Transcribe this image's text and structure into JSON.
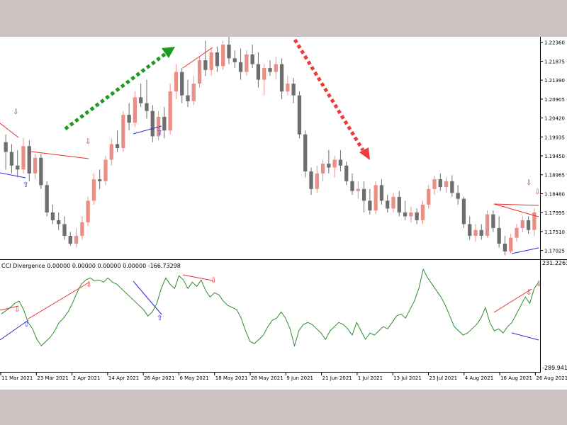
{
  "chart_data": [
    {
      "type": "candlestick",
      "title": "",
      "price_axis": {
        "ticks": [
          "1.22360",
          "1.21875",
          "1.21390",
          "1.20905",
          "1.20420",
          "1.19935",
          "1.19450",
          "1.18965",
          "1.18480",
          "1.17995",
          "1.17510",
          "1.17025"
        ],
        "range": [
          1.168,
          1.225
        ]
      },
      "candles": [
        {
          "o": 1.198,
          "h": 1.2,
          "l": 1.191,
          "c": 1.1955
        },
        {
          "o": 1.1955,
          "h": 1.1975,
          "l": 1.19,
          "c": 1.192
        },
        {
          "o": 1.192,
          "h": 1.196,
          "l": 1.189,
          "c": 1.191
        },
        {
          "o": 1.191,
          "h": 1.199,
          "l": 1.19,
          "c": 1.197
        },
        {
          "o": 1.197,
          "h": 1.1985,
          "l": 1.188,
          "c": 1.19
        },
        {
          "o": 1.19,
          "h": 1.195,
          "l": 1.1885,
          "c": 1.194
        },
        {
          "o": 1.194,
          "h": 1.195,
          "l": 1.186,
          "c": 1.187
        },
        {
          "o": 1.187,
          "h": 1.188,
          "l": 1.179,
          "c": 1.18
        },
        {
          "o": 1.18,
          "h": 1.182,
          "l": 1.177,
          "c": 1.178
        },
        {
          "o": 1.178,
          "h": 1.18,
          "l": 1.1755,
          "c": 1.177
        },
        {
          "o": 1.177,
          "h": 1.179,
          "l": 1.173,
          "c": 1.174
        },
        {
          "o": 1.174,
          "h": 1.175,
          "l": 1.1715,
          "c": 1.172
        },
        {
          "o": 1.172,
          "h": 1.176,
          "l": 1.171,
          "c": 1.174
        },
        {
          "o": 1.174,
          "h": 1.179,
          "l": 1.173,
          "c": 1.1775
        },
        {
          "o": 1.1775,
          "h": 1.184,
          "l": 1.1765,
          "c": 1.183
        },
        {
          "o": 1.183,
          "h": 1.19,
          "l": 1.182,
          "c": 1.1885
        },
        {
          "o": 1.1885,
          "h": 1.191,
          "l": 1.186,
          "c": 1.188
        },
        {
          "o": 1.188,
          "h": 1.1945,
          "l": 1.187,
          "c": 1.1935
        },
        {
          "o": 1.1935,
          "h": 1.199,
          "l": 1.192,
          "c": 1.1975
        },
        {
          "o": 1.1975,
          "h": 1.201,
          "l": 1.1955,
          "c": 1.1965
        },
        {
          "o": 1.1965,
          "h": 1.206,
          "l": 1.1955,
          "c": 1.205
        },
        {
          "o": 1.205,
          "h": 1.208,
          "l": 1.201,
          "c": 1.203
        },
        {
          "o": 1.203,
          "h": 1.211,
          "l": 1.202,
          "c": 1.2095
        },
        {
          "o": 1.2095,
          "h": 1.213,
          "l": 1.207,
          "c": 1.208
        },
        {
          "o": 1.208,
          "h": 1.214,
          "l": 1.204,
          "c": 1.206
        },
        {
          "o": 1.206,
          "h": 1.2075,
          "l": 1.198,
          "c": 1.1995
        },
        {
          "o": 1.1995,
          "h": 1.206,
          "l": 1.1985,
          "c": 1.2045
        },
        {
          "o": 1.2045,
          "h": 1.207,
          "l": 1.199,
          "c": 1.201
        },
        {
          "o": 1.201,
          "h": 1.213,
          "l": 1.2,
          "c": 1.211
        },
        {
          "o": 1.211,
          "h": 1.218,
          "l": 1.209,
          "c": 1.216
        },
        {
          "o": 1.216,
          "h": 1.217,
          "l": 1.208,
          "c": 1.21
        },
        {
          "o": 1.21,
          "h": 1.214,
          "l": 1.207,
          "c": 1.2085
        },
        {
          "o": 1.2085,
          "h": 1.215,
          "l": 1.2075,
          "c": 1.213
        },
        {
          "o": 1.213,
          "h": 1.22,
          "l": 1.212,
          "c": 1.219
        },
        {
          "o": 1.219,
          "h": 1.224,
          "l": 1.215,
          "c": 1.2165
        },
        {
          "o": 1.2165,
          "h": 1.222,
          "l": 1.215,
          "c": 1.221
        },
        {
          "o": 1.221,
          "h": 1.2225,
          "l": 1.216,
          "c": 1.2175
        },
        {
          "o": 1.2175,
          "h": 1.224,
          "l": 1.2165,
          "c": 1.223
        },
        {
          "o": 1.223,
          "h": 1.225,
          "l": 1.218,
          "c": 1.2195
        },
        {
          "o": 1.2195,
          "h": 1.2215,
          "l": 1.217,
          "c": 1.2185
        },
        {
          "o": 1.2185,
          "h": 1.222,
          "l": 1.214,
          "c": 1.216
        },
        {
          "o": 1.216,
          "h": 1.2215,
          "l": 1.215,
          "c": 1.2205
        },
        {
          "o": 1.2205,
          "h": 1.223,
          "l": 1.217,
          "c": 1.218
        },
        {
          "o": 1.218,
          "h": 1.221,
          "l": 1.212,
          "c": 1.214
        },
        {
          "o": 1.214,
          "h": 1.218,
          "l": 1.21,
          "c": 1.217
        },
        {
          "o": 1.217,
          "h": 1.219,
          "l": 1.215,
          "c": 1.216
        },
        {
          "o": 1.216,
          "h": 1.22,
          "l": 1.214,
          "c": 1.218
        },
        {
          "o": 1.218,
          "h": 1.2195,
          "l": 1.209,
          "c": 1.211
        },
        {
          "o": 1.211,
          "h": 1.215,
          "l": 1.21,
          "c": 1.213
        },
        {
          "o": 1.213,
          "h": 1.2145,
          "l": 1.208,
          "c": 1.21
        },
        {
          "o": 1.21,
          "h": 1.211,
          "l": 1.199,
          "c": 1.2
        },
        {
          "o": 1.2,
          "h": 1.201,
          "l": 1.189,
          "c": 1.1905
        },
        {
          "o": 1.1905,
          "h": 1.1915,
          "l": 1.1845,
          "c": 1.186
        },
        {
          "o": 1.186,
          "h": 1.192,
          "l": 1.185,
          "c": 1.19
        },
        {
          "o": 1.19,
          "h": 1.1935,
          "l": 1.188,
          "c": 1.1925
        },
        {
          "o": 1.1925,
          "h": 1.196,
          "l": 1.19,
          "c": 1.1915
        },
        {
          "o": 1.1915,
          "h": 1.1945,
          "l": 1.189,
          "c": 1.1935
        },
        {
          "o": 1.1935,
          "h": 1.196,
          "l": 1.1905,
          "c": 1.192
        },
        {
          "o": 1.192,
          "h": 1.193,
          "l": 1.187,
          "c": 1.188
        },
        {
          "o": 1.188,
          "h": 1.19,
          "l": 1.1845,
          "c": 1.1855
        },
        {
          "o": 1.1855,
          "h": 1.188,
          "l": 1.1835,
          "c": 1.186
        },
        {
          "o": 1.186,
          "h": 1.188,
          "l": 1.18,
          "c": 1.183
        },
        {
          "o": 1.183,
          "h": 1.186,
          "l": 1.1795,
          "c": 1.1805
        },
        {
          "o": 1.1805,
          "h": 1.188,
          "l": 1.1795,
          "c": 1.187
        },
        {
          "o": 1.187,
          "h": 1.1885,
          "l": 1.182,
          "c": 1.183
        },
        {
          "o": 1.183,
          "h": 1.1845,
          "l": 1.18,
          "c": 1.181
        },
        {
          "o": 1.181,
          "h": 1.185,
          "l": 1.18,
          "c": 1.184
        },
        {
          "o": 1.184,
          "h": 1.1855,
          "l": 1.179,
          "c": 1.18
        },
        {
          "o": 1.18,
          "h": 1.183,
          "l": 1.178,
          "c": 1.179
        },
        {
          "o": 1.179,
          "h": 1.1815,
          "l": 1.1775,
          "c": 1.18
        },
        {
          "o": 1.18,
          "h": 1.181,
          "l": 1.177,
          "c": 1.178
        },
        {
          "o": 1.178,
          "h": 1.183,
          "l": 1.177,
          "c": 1.182
        },
        {
          "o": 1.182,
          "h": 1.187,
          "l": 1.181,
          "c": 1.186
        },
        {
          "o": 1.186,
          "h": 1.1895,
          "l": 1.1845,
          "c": 1.1885
        },
        {
          "o": 1.1885,
          "h": 1.19,
          "l": 1.1855,
          "c": 1.1865
        },
        {
          "o": 1.1865,
          "h": 1.189,
          "l": 1.185,
          "c": 1.188
        },
        {
          "o": 1.188,
          "h": 1.1895,
          "l": 1.184,
          "c": 1.185
        },
        {
          "o": 1.185,
          "h": 1.187,
          "l": 1.182,
          "c": 1.1835
        },
        {
          "o": 1.1835,
          "h": 1.184,
          "l": 1.176,
          "c": 1.177
        },
        {
          "o": 1.177,
          "h": 1.179,
          "l": 1.173,
          "c": 1.174
        },
        {
          "o": 1.174,
          "h": 1.177,
          "l": 1.1725,
          "c": 1.1755
        },
        {
          "o": 1.1755,
          "h": 1.177,
          "l": 1.173,
          "c": 1.174
        },
        {
          "o": 1.174,
          "h": 1.1805,
          "l": 1.1735,
          "c": 1.1795
        },
        {
          "o": 1.1795,
          "h": 1.1805,
          "l": 1.175,
          "c": 1.176
        },
        {
          "o": 1.176,
          "h": 1.179,
          "l": 1.171,
          "c": 1.172
        },
        {
          "o": 1.172,
          "h": 1.174,
          "l": 1.169,
          "c": 1.17
        },
        {
          "o": 1.17,
          "h": 1.1745,
          "l": 1.1695,
          "c": 1.1735
        },
        {
          "o": 1.1735,
          "h": 1.177,
          "l": 1.1725,
          "c": 1.176
        },
        {
          "o": 1.176,
          "h": 1.179,
          "l": 1.175,
          "c": 1.178
        },
        {
          "o": 1.178,
          "h": 1.179,
          "l": 1.1745,
          "c": 1.1755
        },
        {
          "o": 1.1755,
          "h": 1.181,
          "l": 1.174,
          "c": 1.18
        }
      ],
      "cci_label": "CCI Divergence 0.00000 0.00000 0.00000 0.00000 -166.73298",
      "cci_axis": {
        "max_label": "231.22637",
        "min_label": "-289.94150",
        "range": [
          -289.9415,
          231.22637
        ]
      },
      "cci_values": [
        -20,
        -5,
        10,
        30,
        40,
        0,
        -60,
        -90,
        -140,
        -170,
        -150,
        -130,
        -100,
        -60,
        -40,
        -10,
        30,
        80,
        120,
        140,
        150,
        135,
        140,
        130,
        150,
        130,
        120,
        100,
        80,
        60,
        40,
        20,
        0,
        -30,
        -10,
        30,
        100,
        150,
        120,
        100,
        160,
        140,
        100,
        130,
        110,
        140,
        90,
        60,
        80,
        70,
        40,
        20,
        10,
        0,
        -40,
        -100,
        -150,
        -160,
        -140,
        -120,
        -80,
        -50,
        -40,
        -10,
        -40,
        -90,
        -170,
        -100,
        -70,
        -60,
        -70,
        -90,
        -110,
        -140,
        -100,
        -80,
        -60,
        -70,
        -90,
        -120,
        -60,
        -100,
        -140,
        -110,
        -120,
        -100,
        -80,
        -90,
        -60,
        -30,
        -20,
        -40,
        0,
        40,
        100,
        190,
        150,
        120,
        90,
        60,
        20,
        -30,
        -80,
        -100,
        -120,
        -110,
        -90,
        -70,
        -40,
        10,
        -60,
        -100,
        -90,
        -110,
        -80,
        -60,
        -20,
        20,
        60,
        30,
        100,
        130
      ],
      "signals": [
        {
          "kind": "bearish-divergence",
          "label": "⇩"
        },
        {
          "kind": "bullish-divergence",
          "label": "⇧"
        }
      ],
      "colors": {
        "bull_body": "#ea8f87",
        "bear_body": "#6e6e6e",
        "cci_line": "#2e8b2e",
        "bearish_line": "#ee2a2a",
        "bullish_line": "#2a2ae0",
        "up_trend_arrow": "#1e9a1e",
        "down_trend_arrow": "#ee3a3a"
      },
      "time_axis": {
        "labels": [
          "11 Mar 2021",
          "23 Mar 2021",
          "2 Apr 2021",
          "14 Apr 2021",
          "26 Apr 2021",
          "6 May 2021",
          "18 May 2021",
          "28 May 2021",
          "9 Jun 2021",
          "21 Jun 2021",
          "1 Jul 2021",
          "13 Jul 2021",
          "23 Jul 2021",
          "4 Aug 2021",
          "16 Aug 2021",
          "26 Aug 2021"
        ]
      }
    }
  ]
}
